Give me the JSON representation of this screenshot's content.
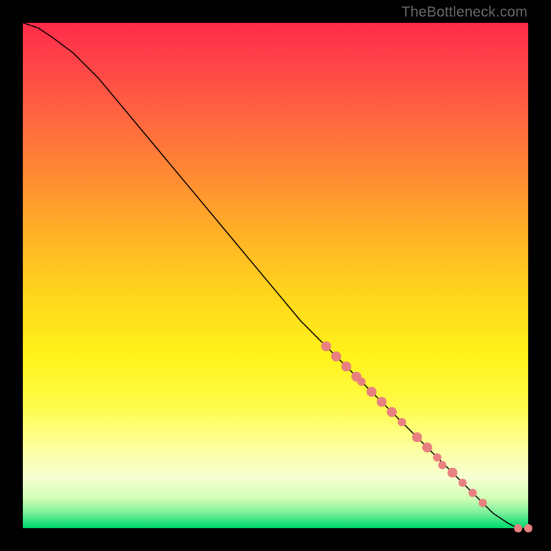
{
  "watermark": "TheBottleneck.com",
  "chart_data": {
    "type": "line",
    "title": "",
    "xlabel": "",
    "ylabel": "",
    "xlim": [
      0,
      100
    ],
    "ylim": [
      0,
      100
    ],
    "grid": false,
    "legend": false,
    "series": [
      {
        "name": "bottleneck-curve",
        "color": "#000000",
        "x": [
          0,
          3,
          6,
          10,
          15,
          20,
          25,
          30,
          35,
          40,
          45,
          50,
          55,
          60,
          65,
          70,
          75,
          80,
          85,
          90,
          93,
          96,
          98,
          100
        ],
        "y": [
          100,
          99,
          97,
          94,
          89,
          83,
          77,
          71,
          65,
          59,
          53,
          47,
          41,
          36,
          31,
          26,
          21,
          16,
          11,
          6,
          3,
          1,
          0,
          0
        ]
      }
    ],
    "markers": {
      "name": "highlighted-points",
      "color": "#e88080",
      "points": [
        {
          "x": 60,
          "y": 36,
          "r": 1.2
        },
        {
          "x": 62,
          "y": 34,
          "r": 1.2
        },
        {
          "x": 64,
          "y": 32,
          "r": 1.2
        },
        {
          "x": 66,
          "y": 30,
          "r": 1.2
        },
        {
          "x": 67,
          "y": 29,
          "r": 1.0
        },
        {
          "x": 69,
          "y": 27,
          "r": 1.2
        },
        {
          "x": 71,
          "y": 25,
          "r": 1.2
        },
        {
          "x": 73,
          "y": 23,
          "r": 1.2
        },
        {
          "x": 75,
          "y": 21,
          "r": 1.0
        },
        {
          "x": 78,
          "y": 18,
          "r": 1.2
        },
        {
          "x": 80,
          "y": 16,
          "r": 1.2
        },
        {
          "x": 82,
          "y": 14,
          "r": 1.0
        },
        {
          "x": 83,
          "y": 12.5,
          "r": 1.0
        },
        {
          "x": 85,
          "y": 11,
          "r": 1.2
        },
        {
          "x": 87,
          "y": 9,
          "r": 1.0
        },
        {
          "x": 89,
          "y": 7,
          "r": 1.0
        },
        {
          "x": 91,
          "y": 5,
          "r": 1.0
        },
        {
          "x": 98,
          "y": 0,
          "r": 1.0
        },
        {
          "x": 100,
          "y": 0,
          "r": 1.0
        }
      ]
    }
  }
}
